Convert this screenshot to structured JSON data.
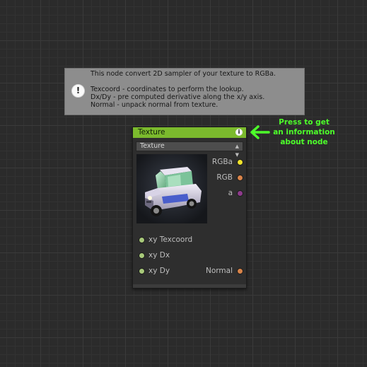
{
  "info": {
    "icon": "exclamation-icon",
    "lines": [
      "This node convert 2D sampler of your texture to RGBa.",
      "",
      "Texcoord - coordinates to perform the lookup.",
      "Dx/Dy - pre computed derivative along the x/y axis.",
      "Normal - unpack normal from texture."
    ]
  },
  "node": {
    "title": "Texture",
    "info_button": "i",
    "dropdown_value": "Texture",
    "outputs": [
      {
        "label": "RGBa",
        "color": "#f0e32c"
      },
      {
        "label": "RGB",
        "color": "#d9844a"
      },
      {
        "label": "a",
        "color": "#8e3b8c"
      }
    ],
    "inputs": [
      {
        "label": "xy Texcoord",
        "color": "#a8c97a"
      },
      {
        "label": "xy Dx",
        "color": "#a8c97a"
      },
      {
        "label": "xy Dy",
        "color": "#a8c97a"
      }
    ],
    "normal_output": {
      "label": "Normal",
      "color": "#d9844a"
    }
  },
  "hint": {
    "lines": [
      "Press to get",
      "an information",
      "about node"
    ],
    "color": "#4dff2a",
    "arrow_icon": "left-arrow-icon"
  }
}
